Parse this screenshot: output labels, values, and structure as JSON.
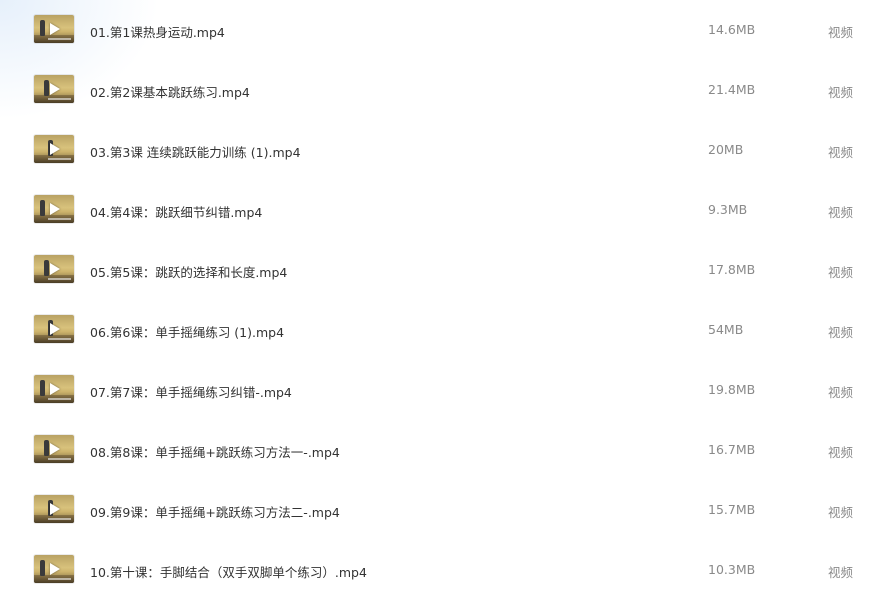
{
  "files": [
    {
      "name": "01.第1课热身运动.mp4",
      "size": "14.6MB",
      "type": "视频",
      "thumbnail": "video-thumbnail",
      "play_icon": "play-icon"
    },
    {
      "name": "02.第2课基本跳跃练习.mp4",
      "size": "21.4MB",
      "type": "视频",
      "thumbnail": "video-thumbnail",
      "play_icon": "play-icon"
    },
    {
      "name": "03.第3课 连续跳跃能力训练 (1).mp4",
      "size": "20MB",
      "type": "视频",
      "thumbnail": "video-thumbnail",
      "play_icon": "play-icon"
    },
    {
      "name": "04.第4课：跳跃细节纠错.mp4",
      "size": "9.3MB",
      "type": "视频",
      "thumbnail": "video-thumbnail",
      "play_icon": "play-icon"
    },
    {
      "name": "05.第5课：跳跃的选择和长度.mp4",
      "size": "17.8MB",
      "type": "视频",
      "thumbnail": "video-thumbnail",
      "play_icon": "play-icon"
    },
    {
      "name": "06.第6课：单手摇绳练习 (1).mp4",
      "size": "54MB",
      "type": "视频",
      "thumbnail": "video-thumbnail",
      "play_icon": "play-icon"
    },
    {
      "name": "07.第7课：单手摇绳练习纠错-.mp4",
      "size": "19.8MB",
      "type": "视频",
      "thumbnail": "video-thumbnail",
      "play_icon": "play-icon"
    },
    {
      "name": "08.第8课：单手摇绳+跳跃练习方法一-.mp4",
      "size": "16.7MB",
      "type": "视频",
      "thumbnail": "video-thumbnail",
      "play_icon": "play-icon"
    },
    {
      "name": "09.第9课：单手摇绳+跳跃练习方法二-.mp4",
      "size": "15.7MB",
      "type": "视频",
      "thumbnail": "video-thumbnail",
      "play_icon": "play-icon"
    },
    {
      "name": "10.第十课：手脚结合（双手双脚单个练习）.mp4",
      "size": "10.3MB",
      "type": "视频",
      "thumbnail": "video-thumbnail",
      "play_icon": "play-icon"
    }
  ],
  "colors": {
    "name_text": "#333333",
    "meta_text": "#8a8a8a",
    "background": "#ffffff"
  }
}
